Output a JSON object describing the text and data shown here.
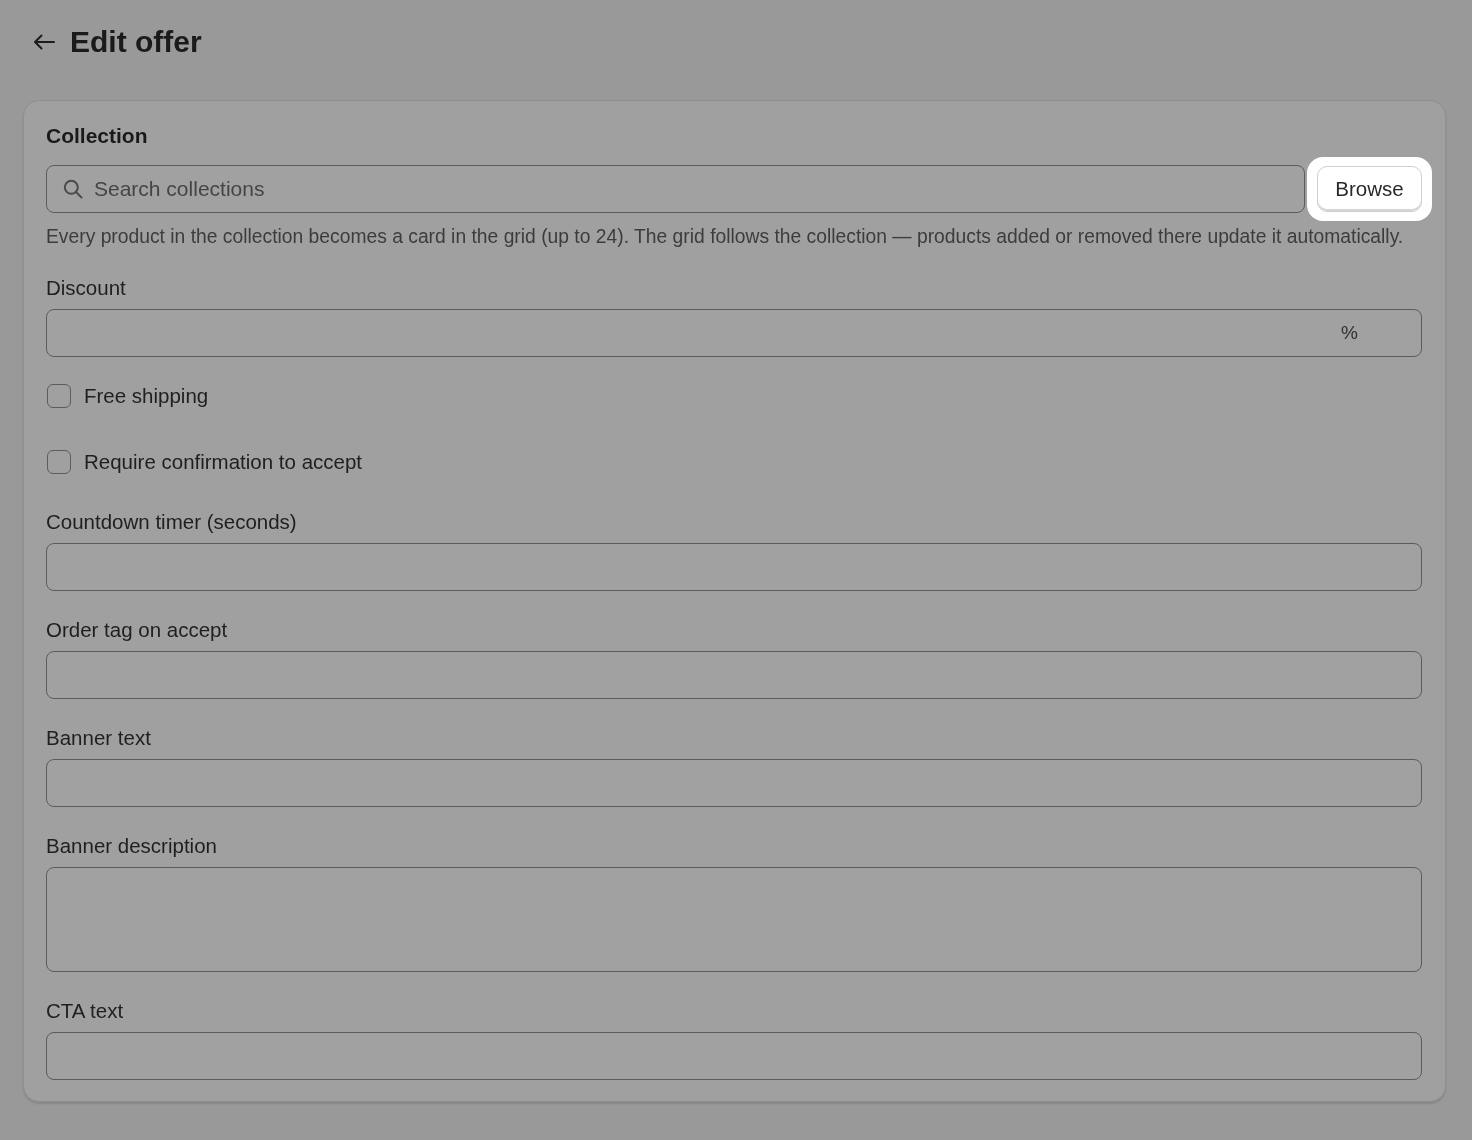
{
  "page": {
    "title": "Edit offer"
  },
  "collection": {
    "label": "Collection",
    "search": {
      "placeholder": "Search collections"
    },
    "browse_button": {
      "label": "Browse",
      "highlighted": true
    },
    "help": "Every product in the collection becomes a card in the grid (up to 24). The grid follows the collection — products added or removed there update it automatically."
  },
  "fields": [
    {
      "kind": "input",
      "label": "Discount",
      "suffix": "%"
    },
    {
      "kind": "checkbox",
      "label": "Free shipping",
      "checked": false
    },
    {
      "kind": "checkbox",
      "label": "Require confirmation to accept",
      "checked": false
    },
    {
      "kind": "input",
      "label": "Countdown timer (seconds)"
    },
    {
      "kind": "input",
      "label": "Order tag on accept"
    },
    {
      "kind": "input",
      "label": "Banner text"
    },
    {
      "kind": "textarea",
      "label": "Banner description"
    },
    {
      "kind": "input",
      "label": "CTA text"
    }
  ]
}
